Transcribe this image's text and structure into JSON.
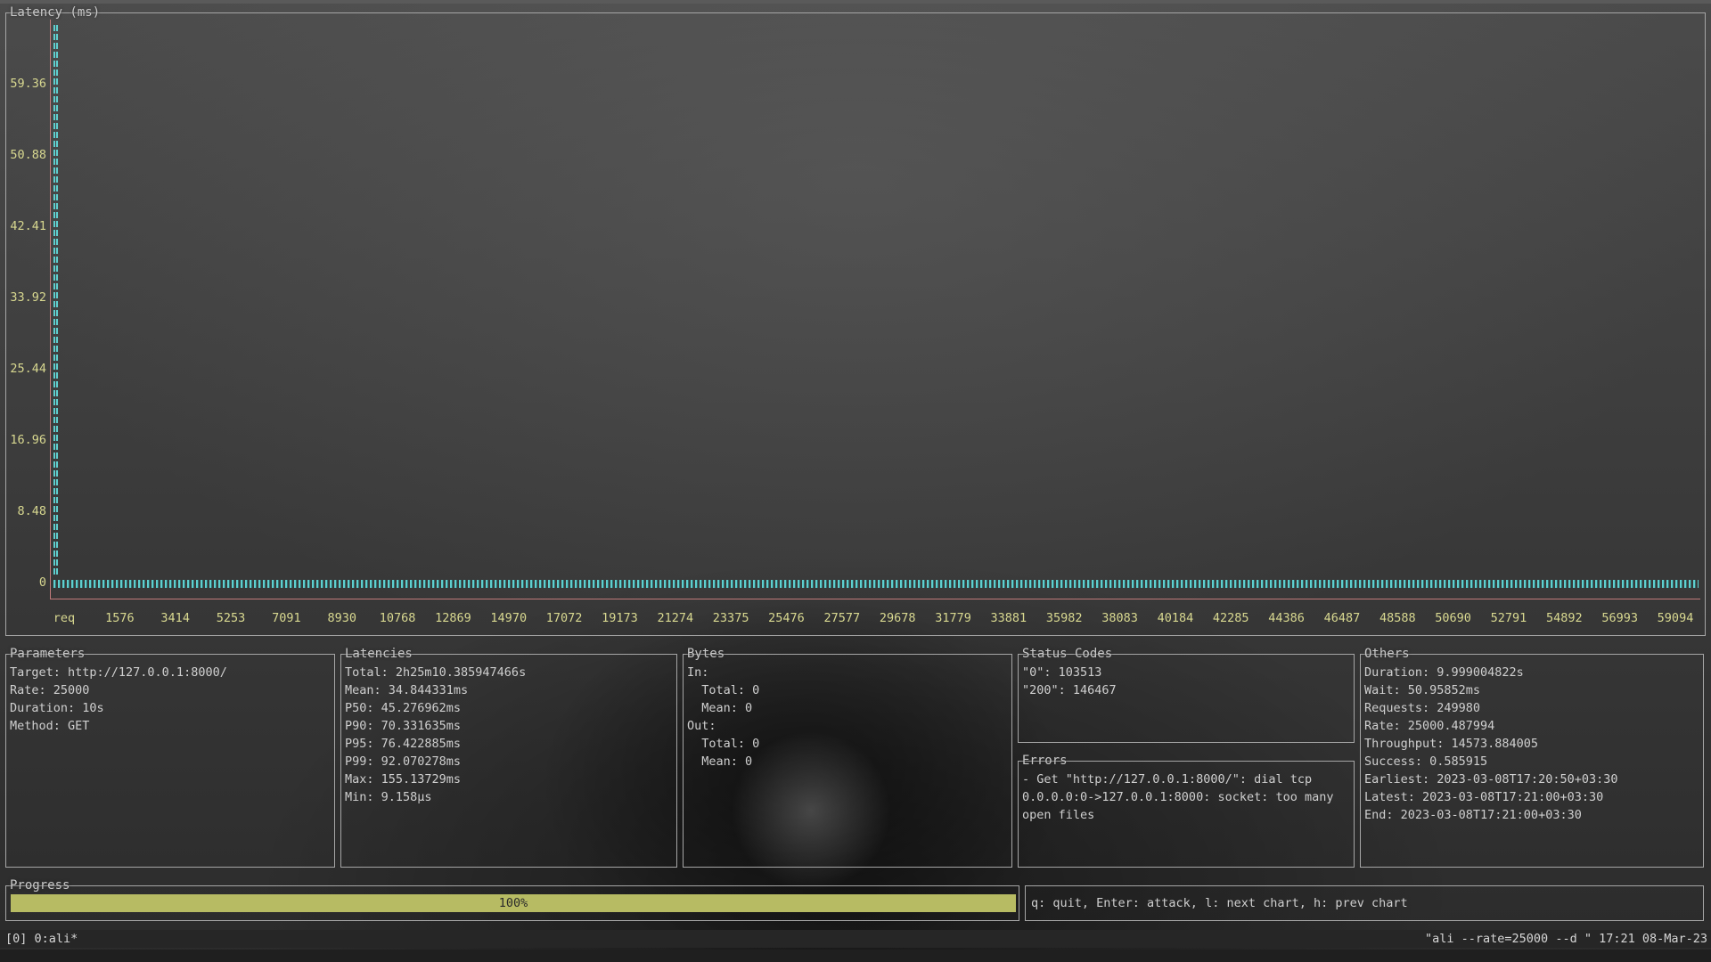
{
  "chart": {
    "title": "Latency (ms)",
    "y_ticks": [
      "59.36",
      "50.88",
      "42.41",
      "33.92",
      "25.44",
      "16.96",
      "8.48",
      "0"
    ],
    "x_ticks": [
      "req",
      "1576",
      "3414",
      "5253",
      "7091",
      "8930",
      "10768",
      "12869",
      "14970",
      "17072",
      "19173",
      "21274",
      "23375",
      "25476",
      "27577",
      "29678",
      "31779",
      "33881",
      "35982",
      "38083",
      "40184",
      "42285",
      "44386",
      "46487",
      "48588",
      "50690",
      "52791",
      "54892",
      "56993",
      "59094"
    ],
    "colors": {
      "ticks": "#d8d890",
      "series": "#5fcfcf",
      "axis": "#c07a7a"
    }
  },
  "parameters": {
    "title": "Parameters",
    "lines": [
      "Target: http://127.0.0.1:8000/",
      "Rate: 25000",
      "Duration: 10s",
      "Method: GET"
    ]
  },
  "latencies": {
    "title": "Latencies",
    "lines": [
      "Total: 2h25m10.385947466s",
      "Mean: 34.844331ms",
      "P50: 45.276962ms",
      "P90: 70.331635ms",
      "P95: 76.422885ms",
      "P99: 92.070278ms",
      "Max: 155.13729ms",
      "Min: 9.158µs"
    ]
  },
  "bytes": {
    "title": "Bytes",
    "lines": [
      "In:",
      "  Total: 0",
      "  Mean: 0",
      "Out:",
      "  Total: 0",
      "  Mean: 0"
    ]
  },
  "status_codes": {
    "title": "Status Codes",
    "lines": [
      "\"0\": 103513",
      "\"200\": 146467"
    ]
  },
  "errors": {
    "title": "Errors",
    "lines": [
      "- Get \"http://127.0.0.1:8000/\": dial tcp",
      "0.0.0.0:0->127.0.0.1:8000: socket: too many",
      "open files"
    ]
  },
  "others": {
    "title": "Others",
    "lines": [
      "Duration: 9.999004822s",
      "Wait: 50.95852ms",
      "Requests: 249980",
      "Rate: 25000.487994",
      "Throughput: 14573.884005",
      "Success: 0.585915",
      "Earliest: 2023-03-08T17:20:50+03:30",
      "Latest: 2023-03-08T17:21:00+03:30",
      "End: 2023-03-08T17:21:00+03:30"
    ]
  },
  "progress": {
    "title": "Progress",
    "label": "100%",
    "fraction": 1.0
  },
  "help": {
    "text": "q: quit, Enter: attack, l: next chart, h: prev chart"
  },
  "statusbar": {
    "left": "[0] 0:ali*",
    "right": "\"ali --rate=25000 --d \" 17:21 08-Mar-23"
  }
}
